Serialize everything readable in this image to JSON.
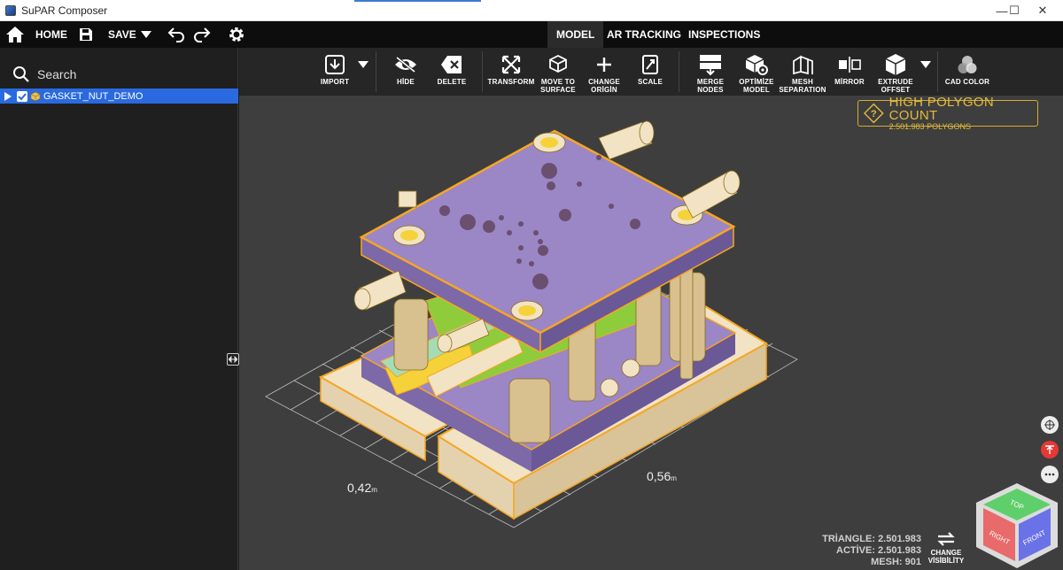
{
  "window": {
    "title": "SuPAR Composer",
    "min_glyph": "—",
    "max_glyph": "☐",
    "close_glyph": "✕"
  },
  "menubar": {
    "home_label": "HOME",
    "save_label": "SAVE",
    "tabs": [
      {
        "label": "MODEL",
        "active": true
      },
      {
        "label": "AR TRACKING",
        "active": false
      },
      {
        "label": "INSPECTIONS",
        "active": false
      }
    ]
  },
  "sidebar": {
    "search_placeholder": "Search",
    "tree": [
      {
        "label": "GASKET_NUT_DEMO",
        "checked": true,
        "selected": true
      }
    ]
  },
  "toolbar": {
    "import": "IMPORT",
    "hide": "HİDE",
    "delete": "DELETE",
    "transform": "TRANSFORM",
    "move_to_surface": "MOVE TO\nSURFACE",
    "change_origin": "CHANGE\nORİGİN",
    "scale": "SCALE",
    "merge_nodes": "MERGE\nNODES",
    "optimize_model": "OPTİMİZE\nMODEL",
    "mesh_separation": "MESH\nSEPARATION",
    "mirror": "MİRROR",
    "extrude_offset": "EXTRUDE\nOFFSET",
    "cad_color": "CAD COLOR"
  },
  "viewport": {
    "warning_title": "HİGH POLYGON COUNT",
    "warning_sub": "2.501.983 POLYGONS",
    "dim_left": "0,42",
    "dim_right": "0,56",
    "dim_unit": "m",
    "stats": {
      "triangle": "TRİANGLE: 2.501.983",
      "active": "ACTİVE: 2.501.983",
      "mesh": "MESH: 901"
    },
    "change_visibility": "CHANGE\nVİSİBİLİTY",
    "view_cube": {
      "top": "TOP",
      "front": "FRONT",
      "right": "RIGHT"
    }
  },
  "colors": {
    "accent_blue": "#2a6ae0",
    "plate_purple": "#9b86c6",
    "highlight_orange": "#f5a623",
    "base_cream": "#f2e3c4",
    "warning_gold": "#d6ad2e"
  }
}
